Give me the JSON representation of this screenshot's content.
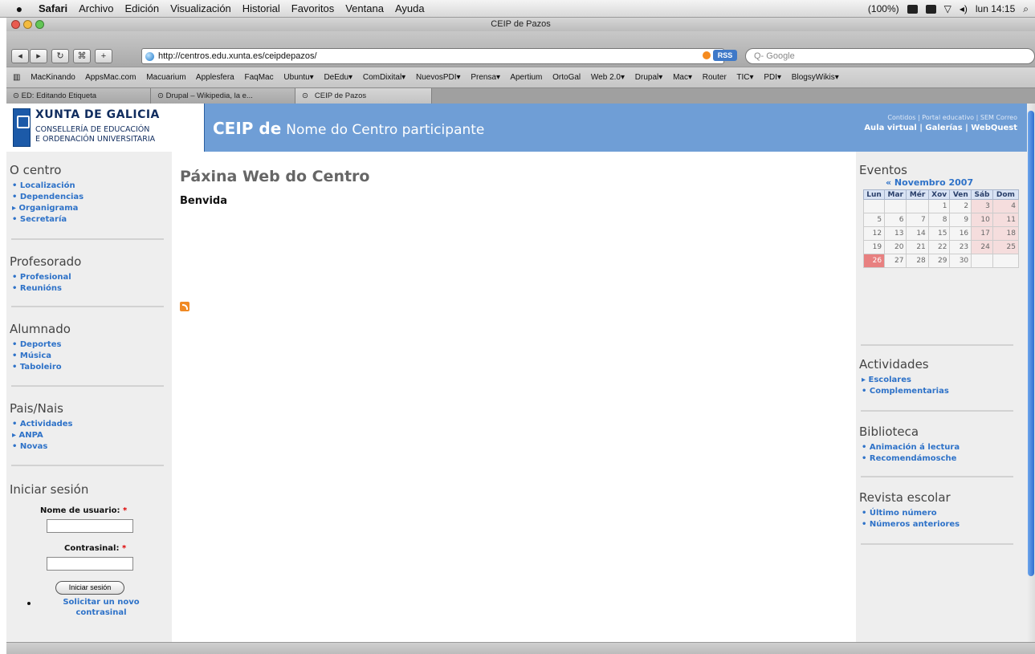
{
  "menubar": {
    "items": [
      "Safari",
      "Archivo",
      "Edición",
      "Visualización",
      "Historial",
      "Favoritos",
      "Ventana",
      "Ayuda"
    ],
    "zoom": "(100%)",
    "clock": "lun 14:15"
  },
  "window": {
    "title": "CEIP de Pazos"
  },
  "toolbar": {
    "url": "http://centros.edu.xunta.es/ceipdepazos/",
    "rss_label": "RSS",
    "search_placeholder": "Q- Google"
  },
  "bookmarks": [
    "MacKinando",
    "AppsMac.com",
    "Macuarium",
    "Applesfera",
    "FaqMac",
    "Ubuntu▾",
    "DeEdu▾",
    "ComDixital▾",
    "NuevosPDI▾",
    "Prensa▾",
    "Apertium",
    "OrtoGal",
    "Web 2.0▾",
    "Drupal▾",
    "Mac▾",
    "Router",
    "TIC▾",
    "PDI▾",
    "BlogsyWikis▾"
  ],
  "tabs": [
    "ED: Editando Etiqueta",
    "Drupal – Wikipedia, la e...",
    "CEIP de Pazos"
  ],
  "header": {
    "logo_line1": "XUNTA DE GALICIA",
    "logo_line2": "CONSELLERÍA DE EDUCACIÓN",
    "logo_line3": "E ORDENACIÓN UNIVERSITARIA",
    "title_bold": "CEIP de",
    "title_rest": "Nome do Centro participante",
    "small_links": "Contidos | Portal educativo | SEM Correo",
    "big_links": "Aula virtual | Galerías | WebQuest"
  },
  "left": {
    "centro": {
      "title": "O centro",
      "items": [
        "Localización",
        "Dependencias",
        "Organigrama",
        "Secretaría"
      ]
    },
    "profesorado": {
      "title": "Profesorado",
      "items": [
        "Profesional",
        "Reunións"
      ]
    },
    "alumnado": {
      "title": "Alumnado",
      "items": [
        "Deportes",
        "Música",
        "Taboleiro"
      ]
    },
    "pais": {
      "title": "Pais/Nais",
      "items": [
        "Actividades",
        "ANPA",
        "Novas"
      ]
    },
    "login": {
      "title": "Iniciar sesión",
      "user_label": "Nome de usuario:",
      "pass_label": "Contrasinal:",
      "required": "*",
      "button": "Iniciar sesión",
      "new_password": "Solicitar un novo contrasinal"
    }
  },
  "main": {
    "title": "Páxina Web do Centro",
    "subtitle": "Benvida"
  },
  "right": {
    "eventos": {
      "title": "Eventos"
    },
    "calendar": {
      "caption": "« Novembro 2007",
      "days": [
        "Lun",
        "Mar",
        "Mér",
        "Xov",
        "Ven",
        "Sáb",
        "Dom"
      ],
      "weeks": [
        [
          "",
          "",
          "",
          "1",
          "2",
          "3",
          "4"
        ],
        [
          "5",
          "6",
          "7",
          "8",
          "9",
          "10",
          "11"
        ],
        [
          "12",
          "13",
          "14",
          "15",
          "16",
          "17",
          "18"
        ],
        [
          "19",
          "20",
          "21",
          "22",
          "23",
          "24",
          "25"
        ],
        [
          "26",
          "27",
          "28",
          "29",
          "30",
          "",
          ""
        ]
      ]
    },
    "actividades": {
      "title": "Actividades",
      "items": [
        "Escolares",
        "Complementarias"
      ]
    },
    "biblioteca": {
      "title": "Biblioteca",
      "items": [
        "Animación á lectura",
        "Recomendámosche"
      ]
    },
    "revista": {
      "title": "Revista escolar",
      "items": [
        "Último número",
        "Números anteriores"
      ]
    }
  }
}
